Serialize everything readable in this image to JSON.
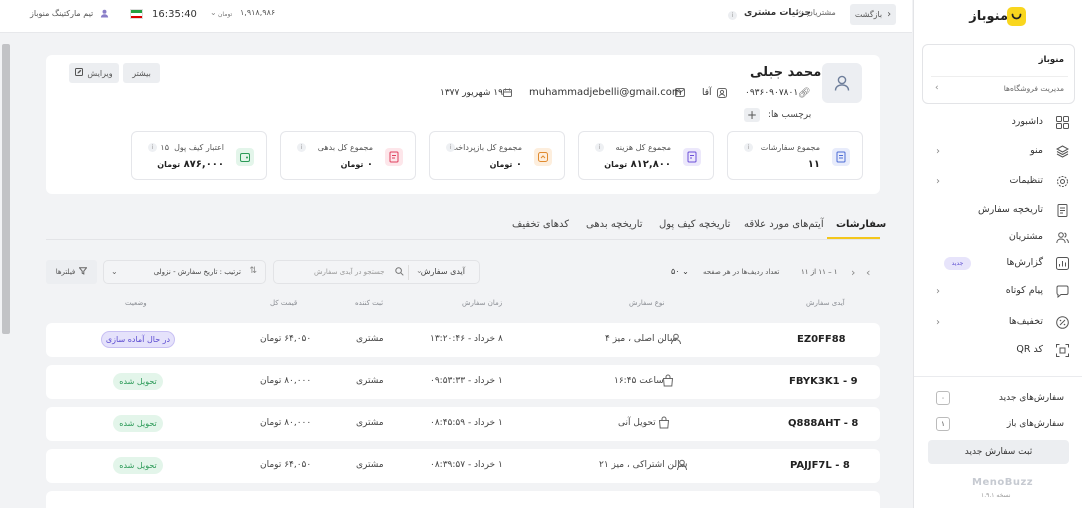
{
  "topbar": {
    "user_label": "تیم مارکتینگ منوباز",
    "time": "16:35:40",
    "balance": "۱,۹۱۸,۹۸۶",
    "balance_unit": "تومان",
    "back_label": "بازگشت",
    "breadcrumb": [
      "مشتریان",
      "جزئیات مشتری"
    ]
  },
  "profile": {
    "name": "محمد جبلی",
    "phone": "۰۹۳۶۰۹۰۷۸۰۱",
    "gender": "آقا",
    "email": "muhammadjebelli@gmail.com",
    "birthday": "۱۹ شهریور ۱۳۷۷",
    "tags_label": "برچسب ها:",
    "more_label": "بیشتر",
    "edit_label": "ویرایش"
  },
  "stats": [
    {
      "title": "مجموع سفارشات",
      "value": "۱۱",
      "unit": "",
      "color": "#e8ecfb",
      "stroke": "#4b6bd6"
    },
    {
      "title": "مجموع کل هزینه",
      "value": "۸۱۲,۸۰۰",
      "unit": "تومان",
      "color": "#ece8fb",
      "stroke": "#6b4fd8"
    },
    {
      "title": "مجموع کل بازپرداخت",
      "value": "۰",
      "unit": "تومان",
      "color": "#fdeedd",
      "stroke": "#e08a2e"
    },
    {
      "title": "مجموع کل بدهی",
      "value": "۰",
      "unit": "تومان",
      "color": "#fde6ea",
      "stroke": "#e0405e"
    },
    {
      "title": "اعتبار کیف پول",
      "value": "۸۷۶,۰۰۰",
      "unit": "تومان",
      "extra": "۱۵",
      "color": "#e3f5ea",
      "stroke": "#2b9a57"
    }
  ],
  "tabs": [
    "سفارشات",
    "آیتم‌های مورد علاقه",
    "تاریخچه کیف پول",
    "تاریخچه بدهی",
    "کدهای تخفیف"
  ],
  "toolbar": {
    "pagination": "۱ – ۱۱ از ۱۱",
    "rows_label": "تعداد ردیف‌ها در هر صفحه",
    "rows_value": "۵۰",
    "search_type": "آیدی سفارش",
    "search_placeholder": "جستجو در آیدی سفارش",
    "sort_label": "ترتیب : تاریخ سفارش - نزولی",
    "filters_label": "فیلترها"
  },
  "table": {
    "headers": [
      "آیدی سفارش",
      "نوع سفارش",
      "زمان سفارش",
      "ثبت کننده",
      "قیمت کل",
      "وضعیت"
    ],
    "rows": [
      {
        "id": "EZ0FF88",
        "type": "سالن اصلی ، میز ۴",
        "type_icon": "waiter-icon",
        "time": "۸ خرداد - ۱۳:۲۰:۴۶",
        "by": "مشتری",
        "price": "۶۴,۰۵۰ تومان",
        "status": "در حال آماده سازی",
        "status_kind": "prep"
      },
      {
        "id": "FBYK3K1 - 9",
        "type": "ساعت ۱۶:۴۵",
        "type_icon": "bag-icon",
        "time": "۱ خرداد - ۰۹:۵۳:۳۳",
        "by": "مشتری",
        "price": "۸۰,۰۰۰ تومان",
        "status": "تحویل شده",
        "status_kind": "done"
      },
      {
        "id": "Q888AHT - 8",
        "type": "تحویل آنی",
        "type_icon": "bag-icon",
        "time": "۱ خرداد - ۰۸:۴۵:۵۹",
        "by": "مشتری",
        "price": "۸۰,۰۰۰ تومان",
        "status": "تحویل شده",
        "status_kind": "done"
      },
      {
        "id": "PAJJF7L - 8",
        "type": "سالن اشتراکی ، میز ۲۱",
        "type_icon": "waiter-icon",
        "time": "۱ خرداد - ۰۸:۳۹:۵۷",
        "by": "مشتری",
        "price": "۶۴,۰۵۰ تومان",
        "status": "تحویل شده",
        "status_kind": "done"
      }
    ]
  },
  "sidebar": {
    "brand": "منوباز",
    "store_name": "منوباز",
    "store_link": "مدیریت فروشگاه‌ها",
    "items": [
      {
        "label": "داشبورد",
        "icon": "grid-icon",
        "chevron": false
      },
      {
        "label": "منو",
        "icon": "layers-icon",
        "chevron": true
      },
      {
        "label": "تنظیمات",
        "icon": "gear-icon",
        "chevron": true
      },
      {
        "label": "تاریخچه سفارش",
        "icon": "receipt-icon",
        "chevron": false
      },
      {
        "label": "مشتریان",
        "icon": "users-icon",
        "chevron": false
      },
      {
        "label": "گزارش‌ها",
        "icon": "chart-icon",
        "chevron": false,
        "badge": "جدید"
      },
      {
        "label": "پیام کوتاه",
        "icon": "message-icon",
        "chevron": true
      },
      {
        "label": "تخفیف‌ها",
        "icon": "percent-icon",
        "chevron": true
      },
      {
        "label": "کد QR",
        "icon": "qr-icon",
        "chevron": false
      }
    ],
    "new_orders_label": "سفارش‌های جدید",
    "new_orders_count": "۰",
    "open_orders_label": "سفارش‌های باز",
    "open_orders_count": "۱",
    "new_order_button": "ثبت سفارش جدید",
    "footer_brand": "MenoBuzz",
    "version": "نسخه ۱.۹.۱"
  }
}
